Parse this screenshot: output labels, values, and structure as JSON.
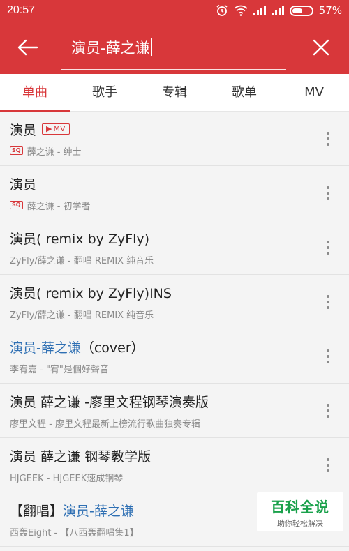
{
  "status": {
    "time": "20:57",
    "battery": "57%"
  },
  "search": {
    "query": "演员-薛之谦"
  },
  "tabs": [
    {
      "label": "单曲",
      "active": true
    },
    {
      "label": "歌手"
    },
    {
      "label": "专辑"
    },
    {
      "label": "歌单"
    },
    {
      "label": "MV"
    }
  ],
  "songs": [
    {
      "title": "演员",
      "badge": "MV",
      "quality": "SQ",
      "subtitle": "薛之谦 - 绅士"
    },
    {
      "title": "演员",
      "quality": "SQ",
      "subtitle": "薛之谦 - 初学者"
    },
    {
      "title": "演员( remix by ZyFly)",
      "subtitle": "ZyFly/薛之谦 - 翻唱 REMIX 纯音乐"
    },
    {
      "title": "演员( remix by ZyFly)INS",
      "subtitle": "ZyFly/薛之谦 - 翻唱 REMIX 纯音乐"
    },
    {
      "title_highlight": "演员-薛之谦",
      "title_suffix": "（cover）",
      "subtitle": "李宥嘉 - \"宥\"是個好聲音"
    },
    {
      "title": "演员 薛之谦 -廖里文程钢琴演奏版",
      "subtitle": "廖里文程 - 廖里文程最新上榜流行歌曲独奏专辑"
    },
    {
      "title": "演员 薛之谦 钢琴教学版",
      "subtitle": "HJGEEK - HJGEEK速成钢琴"
    },
    {
      "title_prefix": "【翻唱】",
      "title_highlight": "演员-薛之谦",
      "subtitle": "西轰Eight - 【八西轰翻唱集1】"
    }
  ],
  "watermark": {
    "main": "百科全说",
    "sub": "助你轻松解决"
  },
  "colors": {
    "accent": "#d8373a",
    "link": "#2e6fb3"
  }
}
